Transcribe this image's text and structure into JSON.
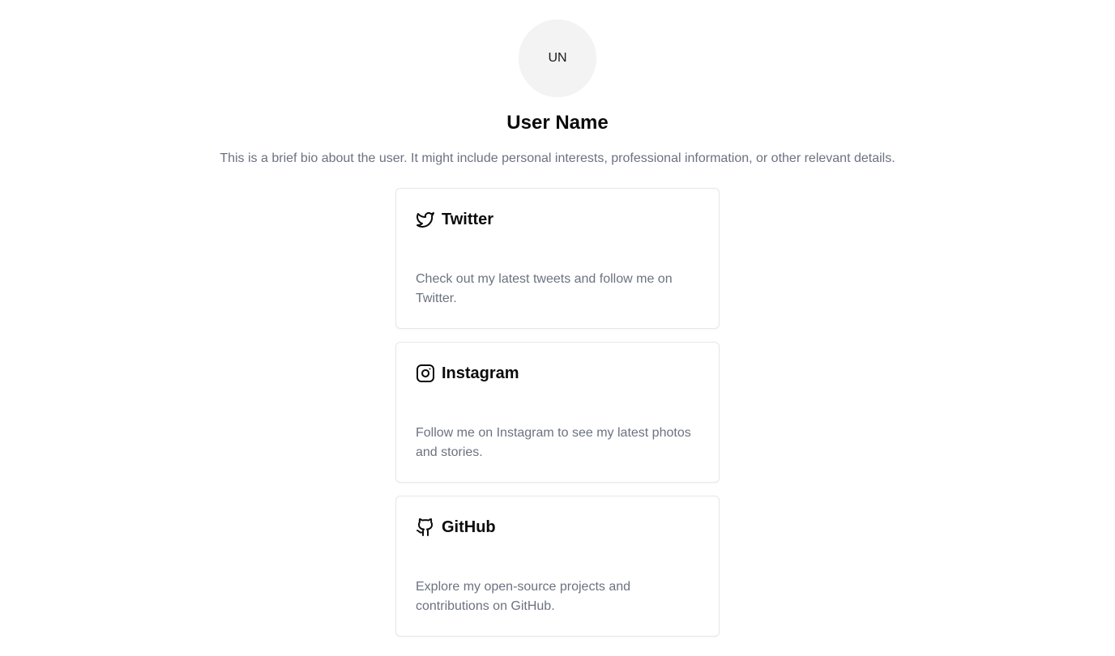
{
  "profile": {
    "initials": "UN",
    "name": "User Name",
    "bio": "This is a brief bio about the user. It might include personal interests, professional information, or other relevant details."
  },
  "links": [
    {
      "icon": "twitter-icon",
      "title": "Twitter",
      "description": "Check out my latest tweets and follow me on Twitter."
    },
    {
      "icon": "instagram-icon",
      "title": "Instagram",
      "description": "Follow me on Instagram to see my latest photos and stories."
    },
    {
      "icon": "github-icon",
      "title": "GitHub",
      "description": "Explore my open-source projects and contributions on GitHub."
    }
  ],
  "colors": {
    "text_primary": "#0b0b0b",
    "text_muted": "#6b7280",
    "card_border": "#e5e7eb",
    "avatar_bg": "#f3f3f3"
  }
}
